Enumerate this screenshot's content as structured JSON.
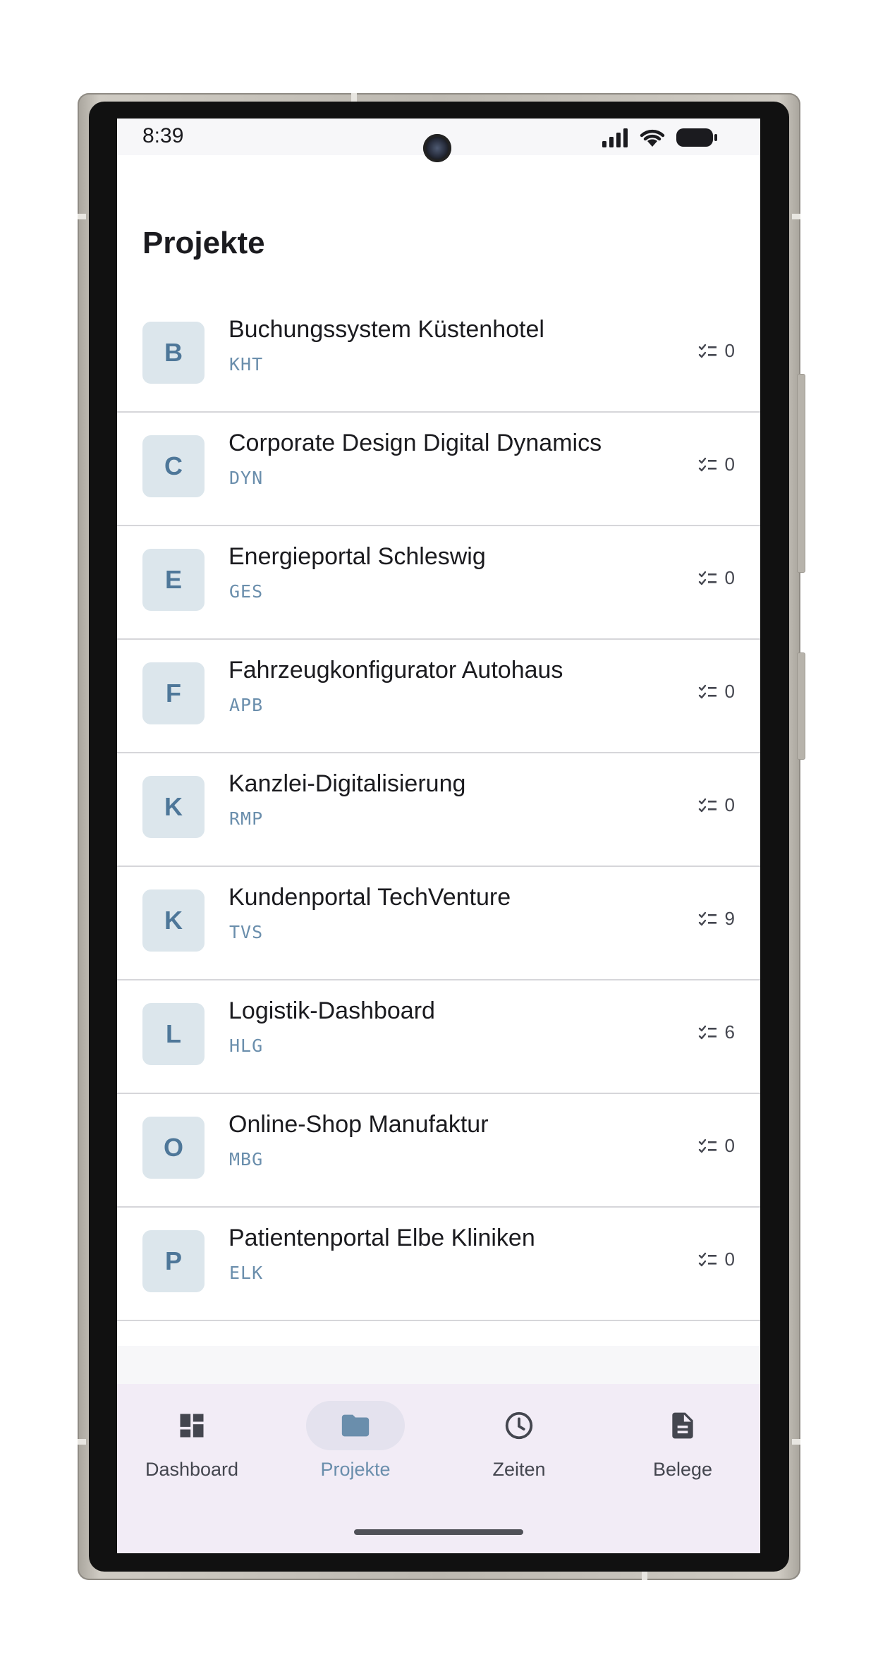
{
  "status_bar": {
    "time": "8:39",
    "icons": [
      "signal-icon",
      "wifi-icon",
      "battery-icon"
    ]
  },
  "header": {
    "title": "Projekte"
  },
  "projects": [
    {
      "initial": "B",
      "name": "Buchungssystem Küstenhotel",
      "code": "KHT",
      "tasks": "0"
    },
    {
      "initial": "C",
      "name": "Corporate Design Digital Dynamics",
      "code": "DYN",
      "tasks": "0"
    },
    {
      "initial": "E",
      "name": "Energieportal Schleswig",
      "code": "GES",
      "tasks": "0"
    },
    {
      "initial": "F",
      "name": "Fahrzeugkonfigurator Autohaus",
      "code": "APB",
      "tasks": "0"
    },
    {
      "initial": "K",
      "name": "Kanzlei-Digitalisierung",
      "code": "RMP",
      "tasks": "0"
    },
    {
      "initial": "K",
      "name": "Kundenportal TechVenture",
      "code": "TVS",
      "tasks": "9"
    },
    {
      "initial": "L",
      "name": "Logistik-Dashboard",
      "code": "HLG",
      "tasks": "6"
    },
    {
      "initial": "O",
      "name": "Online-Shop Manufaktur",
      "code": "MBG",
      "tasks": "0"
    },
    {
      "initial": "P",
      "name": "Patientenportal Elbe Kliniken",
      "code": "ELK",
      "tasks": "0"
    }
  ],
  "bottom_nav": {
    "active": "Projekte",
    "items": [
      {
        "label": "Dashboard",
        "icon": "dashboard-icon"
      },
      {
        "label": "Projekte",
        "icon": "folder-icon"
      },
      {
        "label": "Zeiten",
        "icon": "clock-icon"
      },
      {
        "label": "Belege",
        "icon": "document-icon"
      }
    ]
  },
  "colors": {
    "accent": "#6a8eac",
    "avatar_bg": "#dce6ec",
    "avatar_text": "#4e7799",
    "nav_bg": "#f2ecf6",
    "nav_active_pill": "#e4e2ee",
    "text_primary": "#1b1b1f",
    "divider": "#d6d6da"
  }
}
